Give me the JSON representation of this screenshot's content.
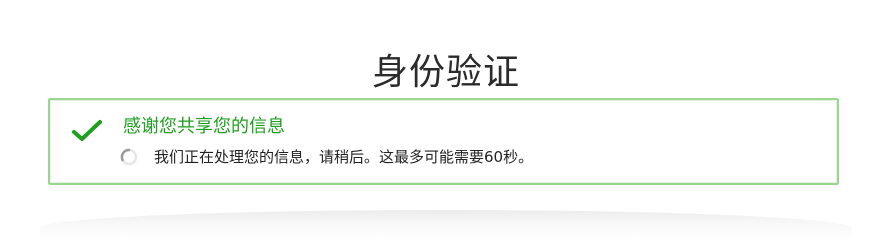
{
  "page": {
    "title": "身份验证"
  },
  "alert": {
    "status": "success",
    "heading": "感谢您共享您的信息",
    "message": "我们正在处理您的信息，请稍后。这最多可能需要60秒。",
    "icon": "checkmark-icon",
    "progress_icon": "spinner-icon"
  },
  "colors": {
    "success": "#1f9f1f",
    "border": "#9ad68f",
    "text": "#222222",
    "title": "#2b2b2b"
  }
}
